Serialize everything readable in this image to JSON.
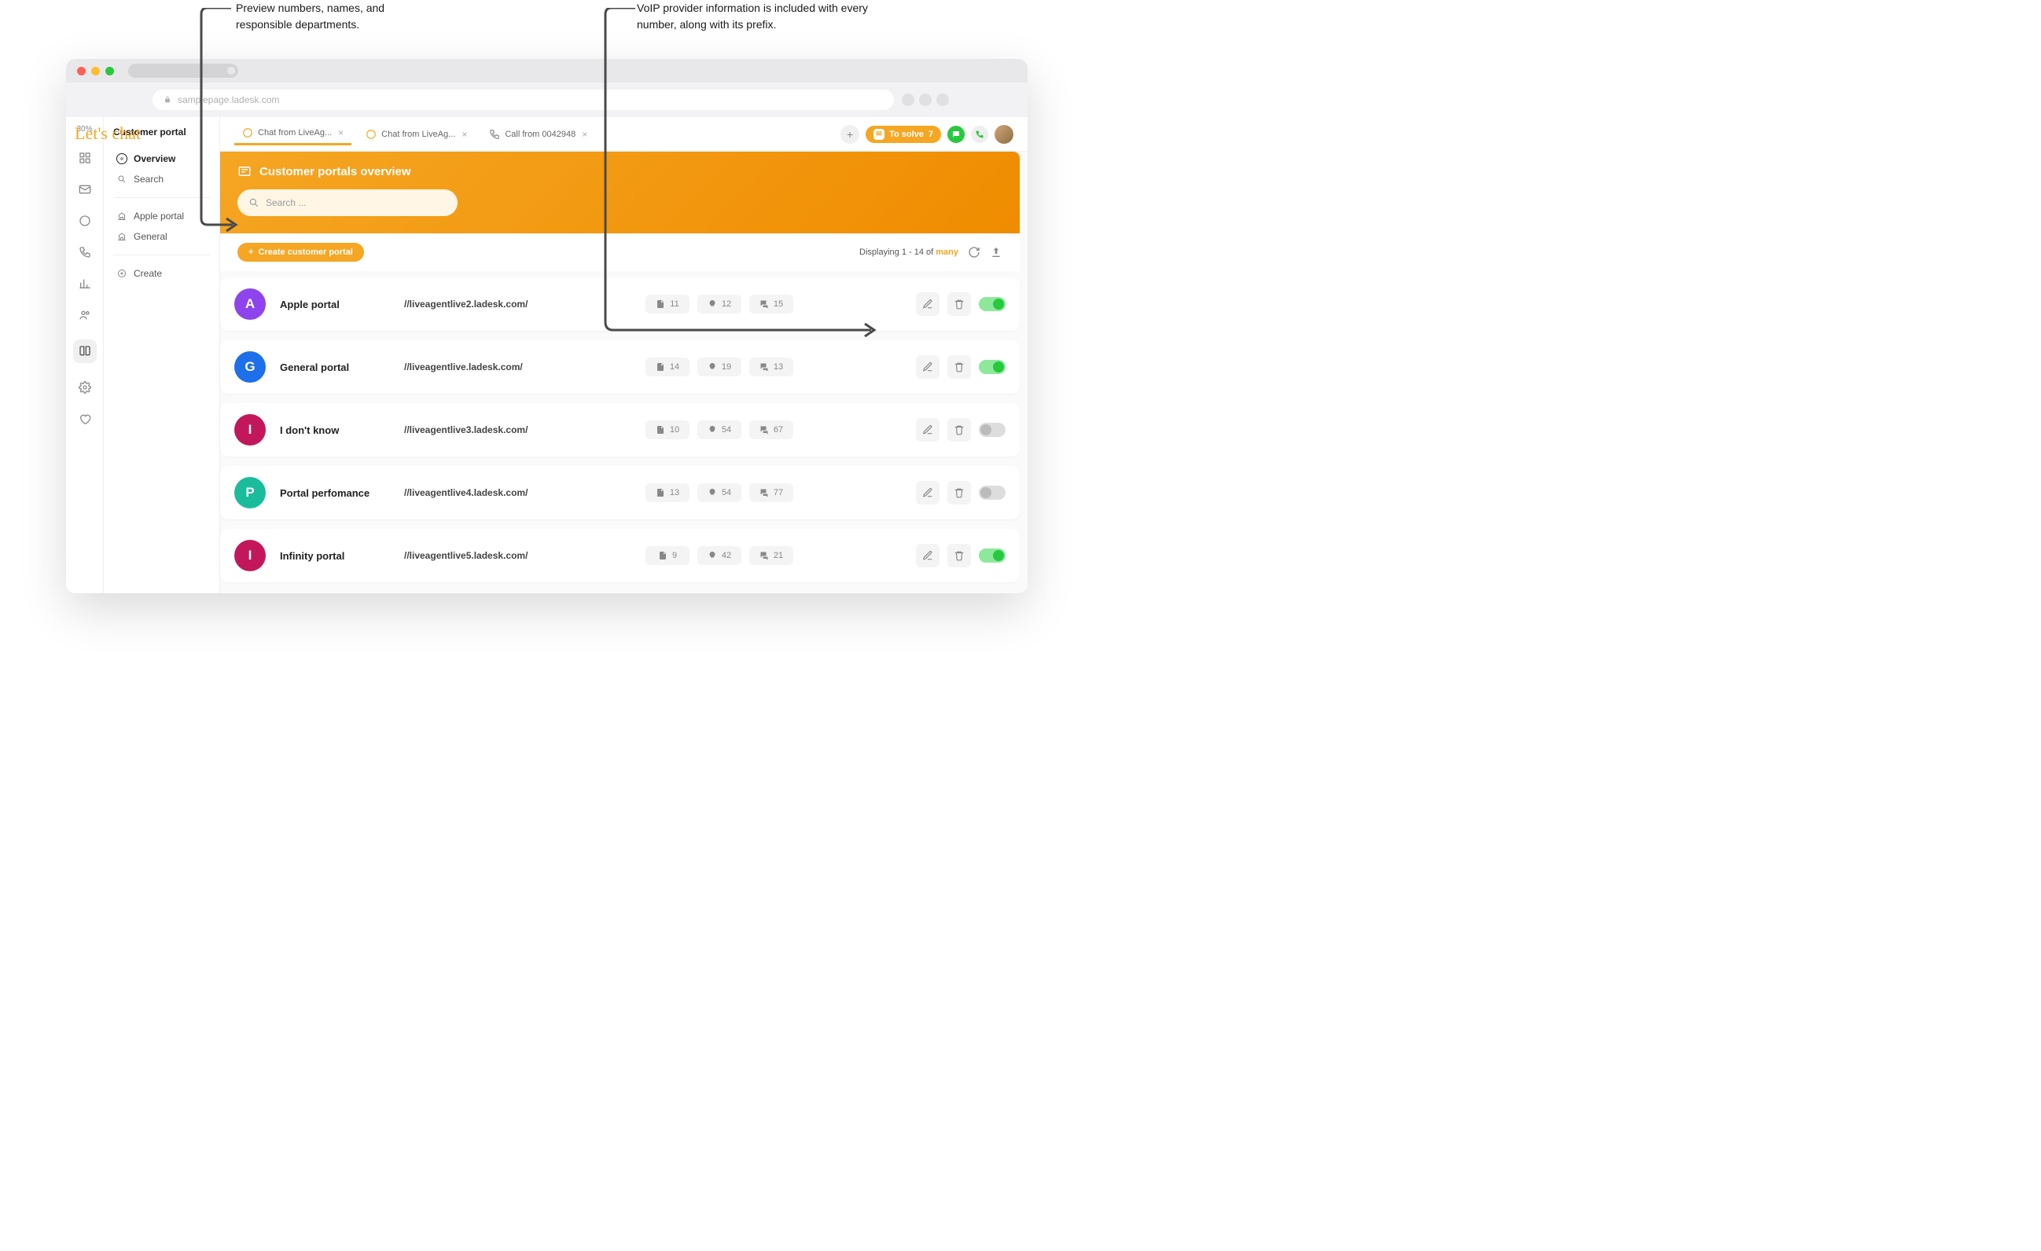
{
  "annotations": {
    "left": "Preview numbers, names, and responsible departments.",
    "right": "VoIP provider information is included with every number, along with its prefix."
  },
  "browser": {
    "url": "samplepage.ladesk.com"
  },
  "brand": "Let's chat",
  "rail_percent": "30%",
  "sidebar": {
    "title": "Customer portal",
    "overview": "Overview",
    "search": "Search",
    "apple": "Apple portal",
    "general": "General",
    "create": "Create"
  },
  "tabs": [
    {
      "label": "Chat from LiveAg...",
      "icon": "chat",
      "active": true
    },
    {
      "label": "Chat from LiveAg...",
      "icon": "chat",
      "active": false
    },
    {
      "label": "Call from 0042948",
      "icon": "phone",
      "active": false
    }
  ],
  "to_solve_label": "To solve",
  "to_solve_count": "7",
  "hero": {
    "title": "Customer portals overview",
    "search_placeholder": "Search ..."
  },
  "toolbar": {
    "create_label": "Create customer portal",
    "displaying_prefix": "Displaying 1 - 14 of ",
    "many": "many"
  },
  "portals": [
    {
      "letter": "A",
      "color": "#8e44ec",
      "name": "Apple portal",
      "url": "//liveagentlive2.ladesk.com/",
      "s1": "11",
      "s2": "12",
      "s3": "15",
      "enabled": true
    },
    {
      "letter": "G",
      "color": "#1e6fea",
      "name": "General portal",
      "url": "//liveagentlive.ladesk.com/",
      "s1": "14",
      "s2": "19",
      "s3": "13",
      "enabled": true
    },
    {
      "letter": "I",
      "color": "#c2185b",
      "name": "I don't know",
      "url": "//liveagentlive3.ladesk.com/",
      "s1": "10",
      "s2": "54",
      "s3": "67",
      "enabled": false
    },
    {
      "letter": "P",
      "color": "#1abc9c",
      "name": "Portal perfomance",
      "url": "//liveagentlive4.ladesk.com/",
      "s1": "13",
      "s2": "54",
      "s3": "77",
      "enabled": false
    },
    {
      "letter": "I",
      "color": "#c2185b",
      "name": "Infinity portal",
      "url": "//liveagentlive5.ladesk.com/",
      "s1": "9",
      "s2": "42",
      "s3": "21",
      "enabled": true
    }
  ]
}
